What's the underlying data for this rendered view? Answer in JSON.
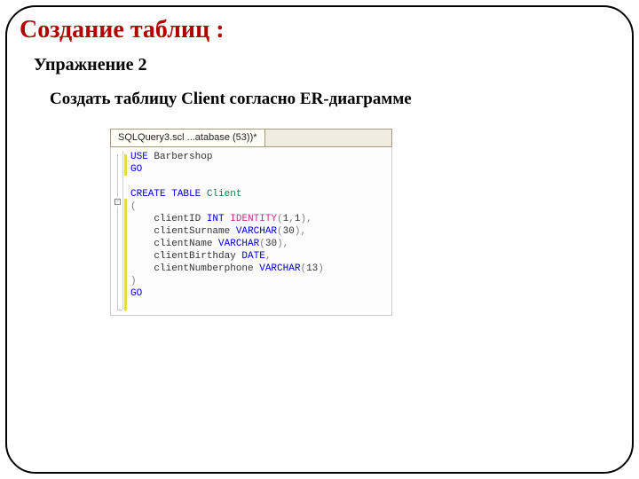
{
  "title": "Создание таблиц :",
  "subtitle": "Упражнение 2",
  "task": "Создать таблицу Client согласно ER-диаграмме",
  "editor": {
    "tab": "SQLQuery3.scl ...atabase (53))*",
    "outline_minus": "-",
    "lines": {
      "l1": {
        "a": "USE",
        "b": " Barbershop"
      },
      "l2": {
        "a": "GO"
      },
      "l3": "",
      "l4": {
        "a": "CREATE",
        "b": " ",
        "c": "TABLE",
        "d": " Client"
      },
      "l5": {
        "a": "("
      },
      "l6": {
        "a": "    clientID ",
        "b": "INT",
        "c": " ",
        "d": "IDENTITY",
        "e": "(",
        "f": "1",
        "g": ",",
        "h": "1",
        "i": ")",
        "j": ","
      },
      "l7": {
        "a": "    clientSurname ",
        "b": "VARCHAR",
        "c": "(",
        "d": "30",
        "e": ")",
        "f": ","
      },
      "l8": {
        "a": "    clientName ",
        "b": "VARCHAR",
        "c": "(",
        "d": "30",
        "e": ")",
        "f": ","
      },
      "l9": {
        "a": "    clientBirthday ",
        "b": "DATE",
        "c": ","
      },
      "l10": {
        "a": "    clientNumberphone ",
        "b": "VARCHAR",
        "c": "(",
        "d": "13",
        "e": ")"
      },
      "l11": {
        "a": ")"
      },
      "l12": {
        "a": "GO"
      }
    }
  }
}
